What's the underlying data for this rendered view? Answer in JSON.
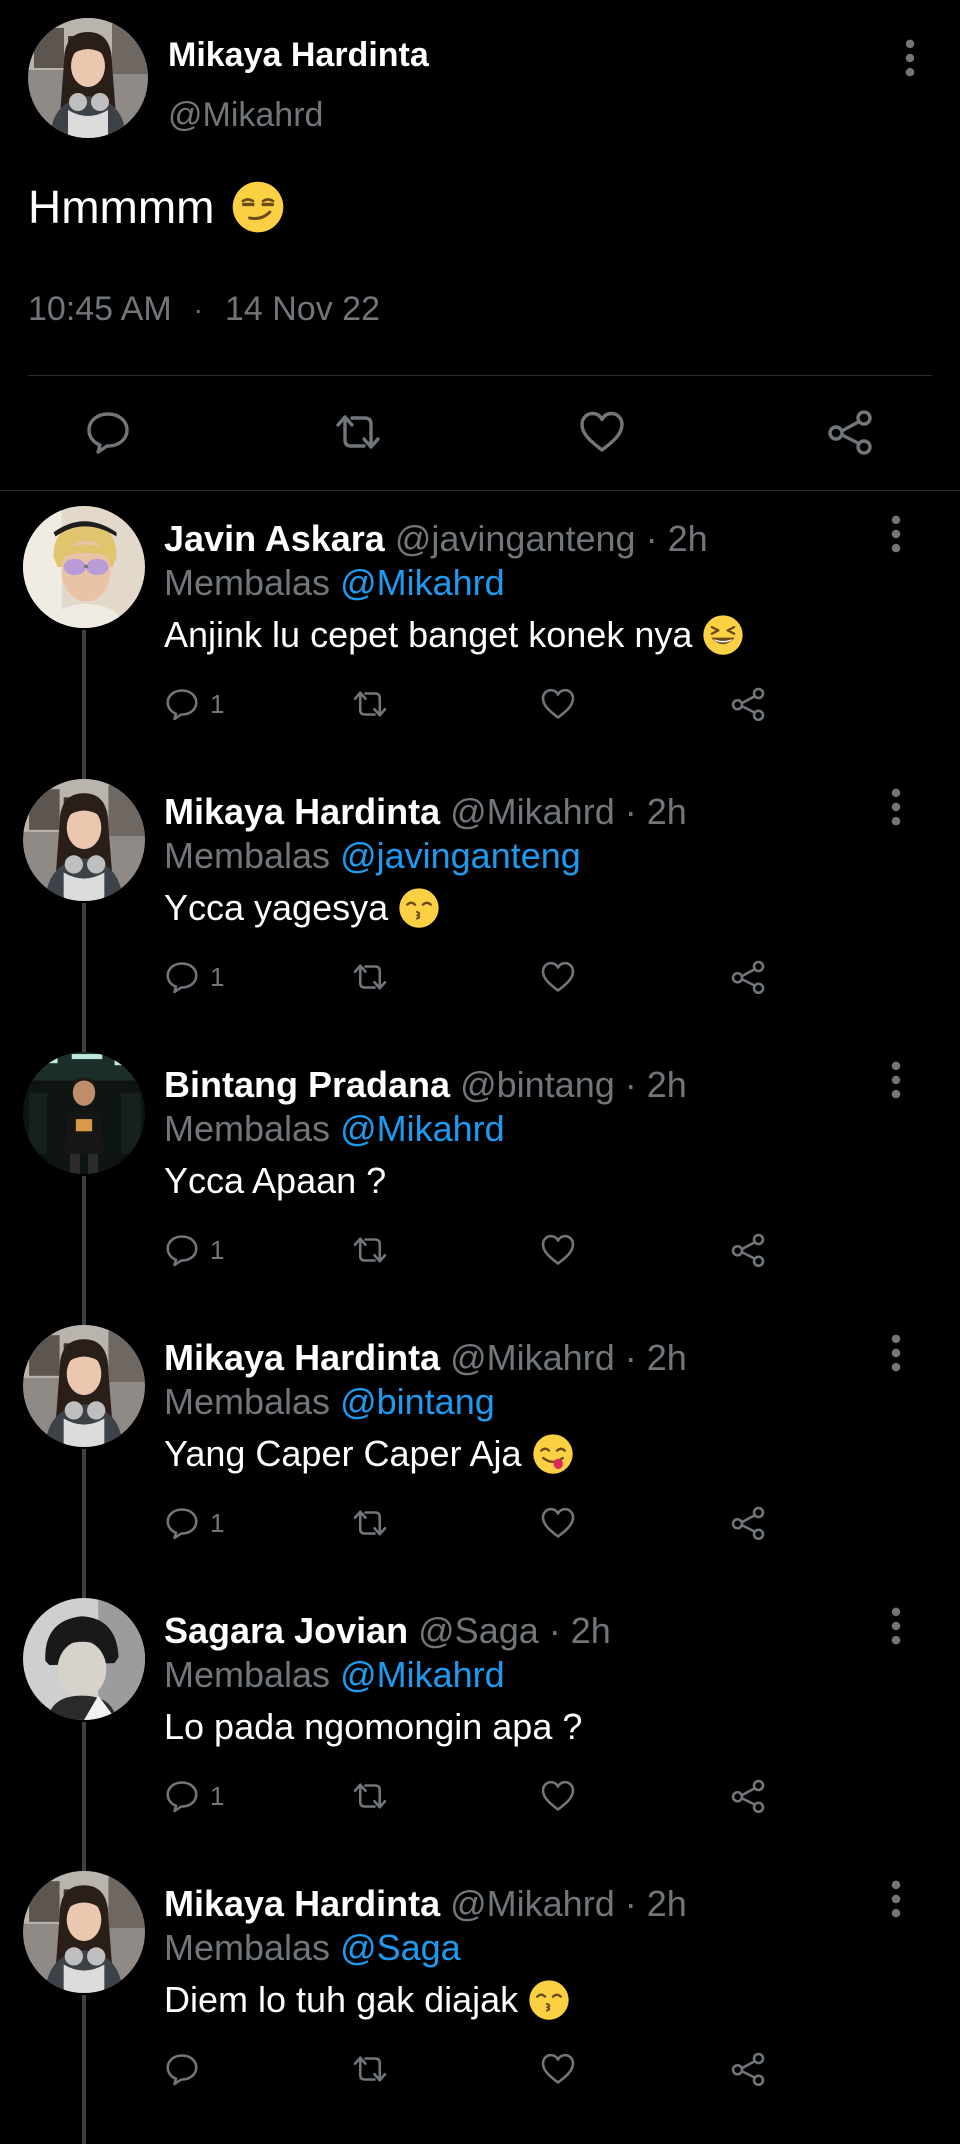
{
  "main_tweet": {
    "author_name": "Mikaya Hardinta",
    "author_handle": "@Mikahrd",
    "text": "Hmmmm",
    "text_emoji": "smirk-emoji",
    "time": "10:45 AM",
    "separator": "·",
    "date": "14 Nov 22"
  },
  "replies": [
    {
      "name": "Javin Askara",
      "handle": "@javinganteng",
      "time": "· 2h",
      "replying_label": "Membalas",
      "mention": "@Mikahrd",
      "text": "Anjink lu cepet banget konek nya",
      "emoji": "grinning-squint-emoji",
      "reply_count": "1",
      "avatar": "blond-sunglasses"
    },
    {
      "name": "Mikaya Hardinta",
      "handle": "@Mikahrd",
      "time": "· 2h",
      "replying_label": "Membalas",
      "mention": "@javinganteng",
      "text": "Ycca yagesya",
      "emoji": "kissing-emoji",
      "reply_count": "1",
      "avatar": "mikaya"
    },
    {
      "name": "Bintang Pradana",
      "handle": "@bintang",
      "time": "· 2h",
      "replying_label": "Membalas",
      "mention": "@Mikahrd",
      "text": "Ycca Apaan ?",
      "emoji": "",
      "reply_count": "1",
      "avatar": "bintang"
    },
    {
      "name": "Mikaya Hardinta",
      "handle": "@Mikahrd",
      "time": "· 2h",
      "replying_label": "Membalas",
      "mention": "@bintang",
      "text": "Yang Caper Caper Aja",
      "emoji": "yum-emoji",
      "reply_count": "1",
      "avatar": "mikaya"
    },
    {
      "name": "Sagara Jovian",
      "handle": "@Saga",
      "time": "· 2h",
      "replying_label": "Membalas",
      "mention": "@Mikahrd",
      "text": "Lo pada ngomongin apa ?",
      "emoji": "",
      "reply_count": "1",
      "avatar": "sagara"
    },
    {
      "name": "Mikaya Hardinta",
      "handle": "@Mikahrd",
      "time": "· 2h",
      "replying_label": "Membalas",
      "mention": "@Saga",
      "text": "Diem lo tuh gak diajak",
      "emoji": "kissing-emoji",
      "reply_count": "",
      "avatar": "mikaya"
    }
  ],
  "icons": {
    "more": "more-vertical-icon",
    "reply": "reply-bubble-icon",
    "retweet": "retweet-icon",
    "like": "heart-icon",
    "share": "share-icon"
  },
  "colors": {
    "background": "#000000",
    "text": "#ffffff",
    "muted": "#71767b",
    "mention": "#1d9bf0",
    "divider": "#2a2d30",
    "thread_line": "#3d4145"
  }
}
